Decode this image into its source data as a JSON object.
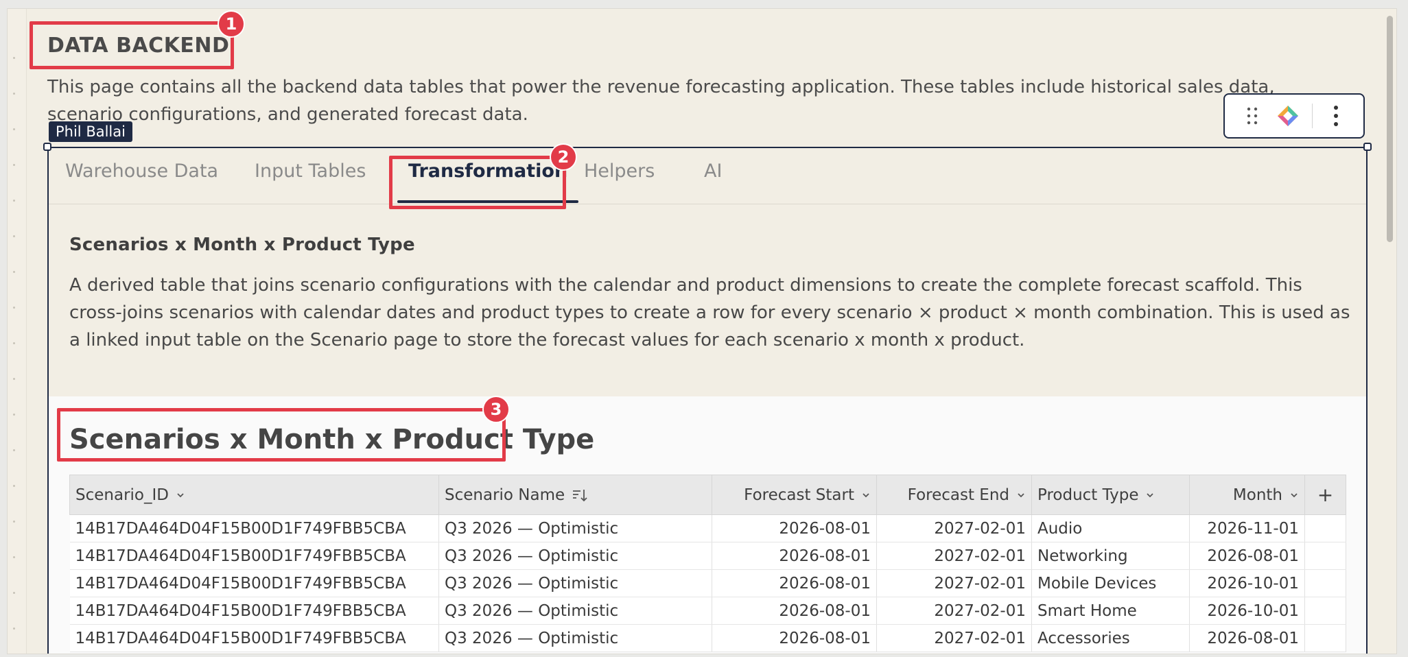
{
  "page": {
    "heading": "DATA BACKEND",
    "description": "This page contains all the backend data tables that power the revenue forecasting application. These tables include historical sales data, scenario configurations, and generated forecast data.",
    "author_tag": "Phil Ballai"
  },
  "toolbar": {
    "drag_icon": "drag-handle-icon",
    "ai_icon": "gem-icon",
    "menu_icon": "more-vertical-icon"
  },
  "tabs": [
    {
      "label": "Warehouse Data",
      "active": false
    },
    {
      "label": "Input Tables",
      "active": false
    },
    {
      "label": "Transformation",
      "active": true
    },
    {
      "label": "Helpers",
      "active": false
    },
    {
      "label": "AI",
      "active": false
    }
  ],
  "section": {
    "title": "Scenarios x Month x Product Type",
    "description": "A derived table that joins scenario configurations with the calendar and product dimensions to create the complete forecast scaffold. This cross-joins scenarios with calendar dates and product types to create a row for every scenario × product × month combination. This is used as a linked input table on the Scenario page to store the forecast values for each scenario x month x product."
  },
  "table": {
    "title": "Scenarios x Month x Product Type",
    "columns": [
      {
        "label": "Scenario_ID",
        "icon": "chevron-down-icon",
        "align": "left"
      },
      {
        "label": "Scenario Name",
        "icon": "sort-descending-icon",
        "align": "left"
      },
      {
        "label": "Forecast Start",
        "icon": "chevron-down-icon",
        "align": "right"
      },
      {
        "label": "Forecast End",
        "icon": "chevron-down-icon",
        "align": "right"
      },
      {
        "label": "Product Type",
        "icon": "chevron-down-icon",
        "align": "left"
      },
      {
        "label": "Month",
        "icon": "chevron-down-icon",
        "align": "right"
      }
    ],
    "add_column_label": "+",
    "rows": [
      [
        "14B17DA464D04F15B00D1F749FBB5CBA",
        "Q3 2026 — Optimistic",
        "2026-08-01",
        "2027-02-01",
        "Audio",
        "2026-11-01"
      ],
      [
        "14B17DA464D04F15B00D1F749FBB5CBA",
        "Q3 2026 — Optimistic",
        "2026-08-01",
        "2027-02-01",
        "Networking",
        "2026-08-01"
      ],
      [
        "14B17DA464D04F15B00D1F749FBB5CBA",
        "Q3 2026 — Optimistic",
        "2026-08-01",
        "2027-02-01",
        "Mobile Devices",
        "2026-10-01"
      ],
      [
        "14B17DA464D04F15B00D1F749FBB5CBA",
        "Q3 2026 — Optimistic",
        "2026-08-01",
        "2027-02-01",
        "Smart Home",
        "2026-10-01"
      ],
      [
        "14B17DA464D04F15B00D1F749FBB5CBA",
        "Q3 2026 — Optimistic",
        "2026-08-01",
        "2027-02-01",
        "Accessories",
        "2026-08-01"
      ]
    ]
  },
  "annotations": [
    "1",
    "2",
    "3"
  ],
  "colors": {
    "accent": "#1f2a44",
    "annotation": "#e23b48",
    "canvas": "#f2eee4"
  }
}
